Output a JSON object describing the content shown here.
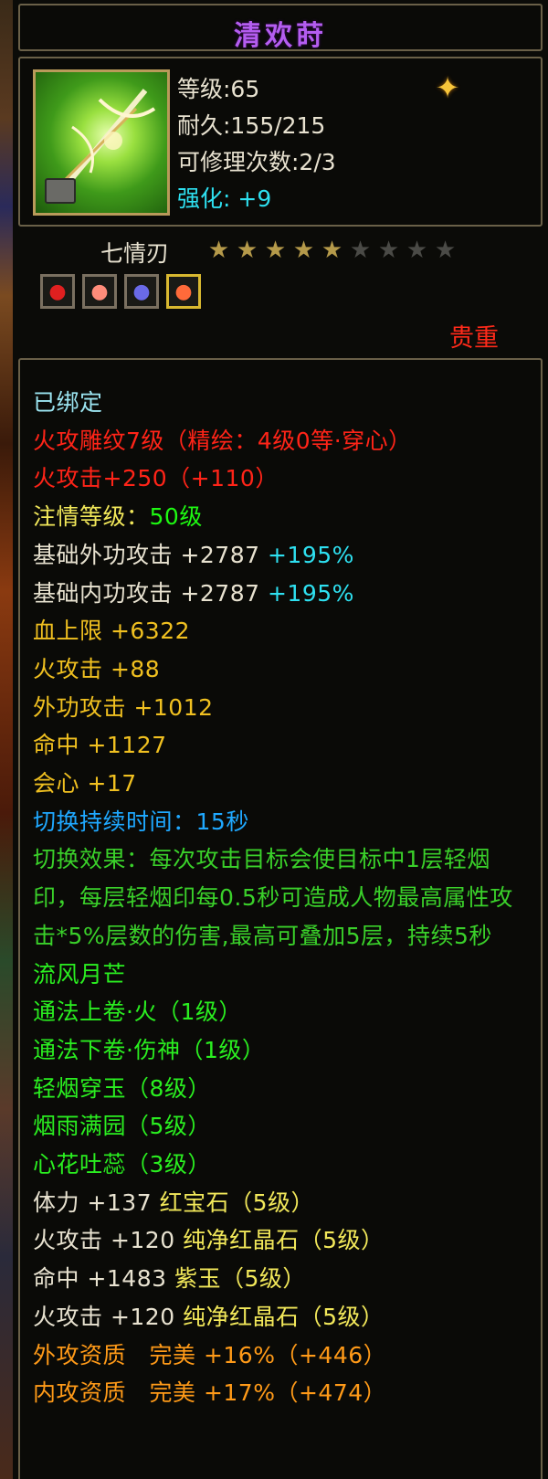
{
  "item": {
    "name": "清欢莳",
    "level": "等级:65",
    "durability": "耐久:155/215",
    "repair_count": "可修理次数:2/3",
    "enhance_label": "强化:",
    "enhance_value": "+9",
    "weapon_type": "七情刃",
    "stars_total": 9,
    "stars_filled": 5,
    "rarity": "贵重",
    "gems": [
      "red-gem-icon",
      "pink-gem-icon",
      "blue-gem-icon",
      "orange-gem-icon"
    ]
  },
  "attrs": {
    "bound": "已绑定",
    "engrave": "火攻雕纹7级（精绘：4级0等·穿心）",
    "fire_main": "火攻击+250（+110）",
    "infuse_label": "注情等级：",
    "infuse_value": "50级",
    "base_out_label": "基础外功攻击 +2787",
    "base_out_pct": "+195%",
    "base_in_label": "基础内功攻击 +2787",
    "base_in_pct": "+195%",
    "hp": "血上限 +6322",
    "fire": "火攻击 +88",
    "outer": "外功攻击 +1012",
    "hit": "命中 +1127",
    "crit": "会心 +17",
    "switch_dur_label": "切换持续时间：",
    "switch_dur_value": "15秒",
    "switch_effect": "切换效果：每次攻击目标会使目标中1层轻烟印，每层轻烟印每0.5秒可造成人物最高属性攻击*5%层数的伤害,最高可叠加5层，持续5秒",
    "set_name": "流风月芒",
    "skill1": "通法上卷·火（1级）",
    "skill2": "通法下卷·伤神（1级）",
    "skill3": "轻烟穿玉（8级）",
    "skill4": "烟雨满园（5级）",
    "skill5": "心花吐蕊（3级）",
    "gem1_stat": "体力 +137",
    "gem1_name": "红宝石（5级）",
    "gem2_stat": "火攻击 +120",
    "gem2_name": "纯净红晶石（5级）",
    "gem3_stat": "命中 +1483",
    "gem3_name": "紫玉（5级）",
    "gem4_stat": "火攻击 +120",
    "gem4_name": "纯净红晶石（5级）",
    "apt1": "外攻资质　完美 +16%（+446）",
    "apt2": "内攻资质　完美 +17%（+474）"
  }
}
